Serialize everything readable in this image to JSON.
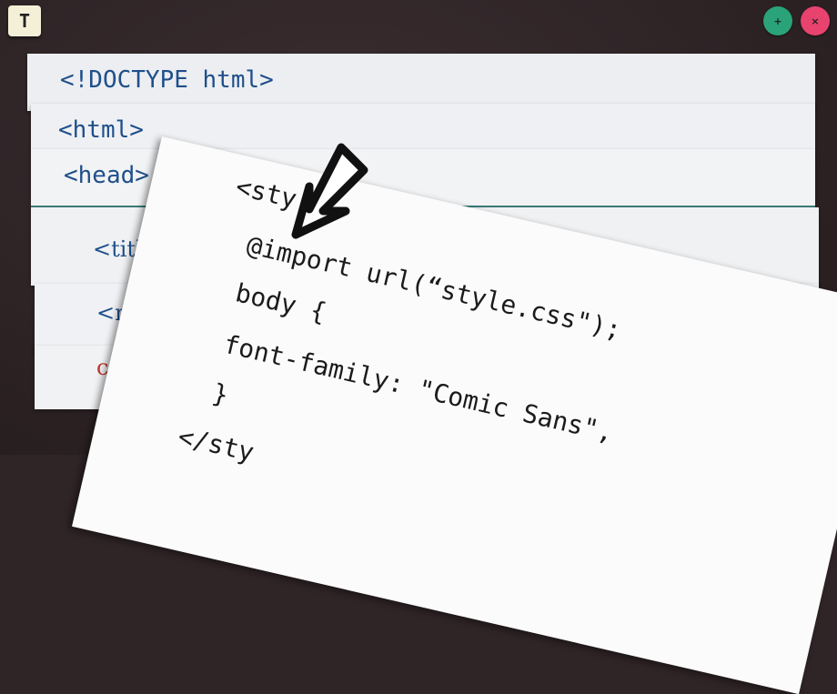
{
  "toolbar": {
    "app_icon_glyph": "T",
    "plus_glyph": "+",
    "close_glyph": "×"
  },
  "html_strips": [
    "<!DOCTYPE html>",
    "<html>",
    "<head>",
    "<title",
    "<me",
    "co"
  ],
  "css_sheet": {
    "lines": [
      "<sty",
      "@import url(“style.css\");",
      "body {",
      "font-family: \"Comic Sans\",",
      "}",
      "</sty"
    ]
  },
  "colors": {
    "background": "#2f2426",
    "tag_blue": "#1f4f8a",
    "tag_red": "#c0392b",
    "plus_button": "#2aa37a",
    "close_button": "#e8436f"
  },
  "icons": [
    "app-text-icon",
    "plus-icon",
    "close-icon",
    "arrow-pointer-icon"
  ]
}
